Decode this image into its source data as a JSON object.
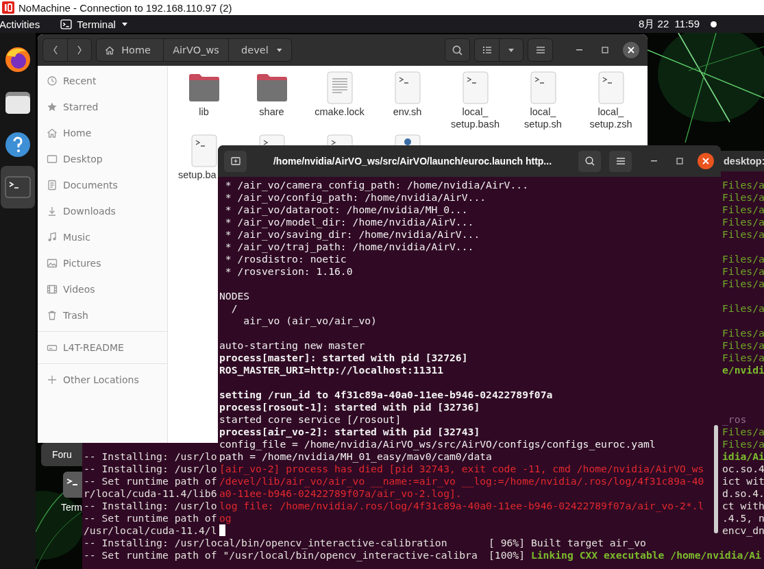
{
  "remote_window": {
    "title": "NoMachine - Connection to 192.168.110.97 (2)"
  },
  "top_bar": {
    "activities": "Activities",
    "app_menu": "Terminal",
    "clock": "8月 22  11:59"
  },
  "dock": {
    "items": [
      {
        "kind": "browser",
        "selected": false
      },
      {
        "kind": "files",
        "selected": false
      },
      {
        "kind": "help",
        "selected": false
      },
      {
        "kind": "terminal",
        "selected": true
      }
    ]
  },
  "desktop_items": [
    {
      "label": "Foru",
      "selected": true
    },
    {
      "label": "Term",
      "kind": "terminal",
      "selected": false
    }
  ],
  "terminal_behind_left": {
    "lines": [
      {
        "text": "-- Installing: /usr/lo"
      },
      {
        "text": "-- Installing: /usr/lo"
      },
      {
        "text": "-- Set runtime path of"
      },
      {
        "text": "r/local/cuda-11.4/lib6"
      },
      {
        "text": "-- Installing: /usr/lo"
      },
      {
        "text": "-- Set runtime path of"
      },
      {
        "text": "/usr/local/cuda-11.4/l"
      },
      {
        "text": "-- Installing: /usr/local/bin/opencv_interactive-calibration"
      },
      {
        "text": "-- Set runtime path of \"/usr/local/bin/opencv_interactive-calibra"
      }
    ]
  },
  "terminal_behind_right": {
    "title": "desktop:",
    "lines_right_edge": [
      {
        "text": "Files/a",
        "kind": "match"
      },
      {
        "text": "Files/a",
        "kind": "match"
      },
      {
        "text": "Files/a",
        "kind": "match"
      },
      {
        "text": "Files/a",
        "kind": "match"
      },
      {
        "text": "Files/a",
        "kind": "match"
      },
      {
        "kind": "blank"
      },
      {
        "text": "Files/a",
        "kind": "match"
      },
      {
        "text": "Files/a",
        "kind": "match"
      },
      {
        "text": "Files/a",
        "kind": "match"
      },
      {
        "kind": "blank"
      },
      {
        "text": "Files/a",
        "kind": "match"
      },
      {
        "kind": "blank"
      },
      {
        "text": "Files/a",
        "kind": "match"
      },
      {
        "text": "Files/a",
        "kind": "match"
      },
      {
        "text": "Files/a",
        "kind": "match"
      },
      {
        "text": "e/nvidi",
        "kind": "target"
      },
      {
        "kind": "blank"
      },
      {
        "kind": "blank"
      },
      {
        "kind": "blank"
      },
      {
        "text": "_ros",
        "kind": "muted"
      },
      {
        "text": "Files/a",
        "kind": "match"
      },
      {
        "text": "Files/a",
        "kind": "match"
      },
      {
        "text": "idia/Ai",
        "kind": "target"
      },
      {
        "text": "oc.so.4"
      },
      {
        "text": "ict wit"
      },
      {
        "text": "d.so.4."
      },
      {
        "text": "ct with"
      },
      {
        "text": ".4.5, n"
      },
      {
        "text": "encv_dn"
      }
    ],
    "lines": [
      {
        "text": "[ 96%] Built target air_vo"
      },
      {
        "spans": [
          {
            "text": "[100%] "
          },
          {
            "text": "Linking CXX executable /home/nvidia/Ai",
            "kind": "target"
          }
        ]
      }
    ]
  },
  "file_manager": {
    "path": [
      {
        "label": "Home",
        "kind": "home"
      },
      {
        "label": "AirVO_ws",
        "kind": "folder"
      },
      {
        "label": "devel",
        "kind": "current"
      }
    ],
    "sidebar": {
      "places": [
        {
          "label": "Recent",
          "kind": "recent"
        },
        {
          "label": "Starred",
          "kind": "starred"
        },
        {
          "label": "Home",
          "kind": "home"
        },
        {
          "label": "Desktop",
          "kind": "desktop"
        },
        {
          "label": "Documents",
          "kind": "documents"
        },
        {
          "label": "Downloads",
          "kind": "downloads"
        },
        {
          "label": "Music",
          "kind": "music"
        },
        {
          "label": "Pictures",
          "kind": "pictures"
        },
        {
          "label": "Videos",
          "kind": "videos"
        },
        {
          "label": "Trash",
          "kind": "trash"
        }
      ],
      "devices": [
        {
          "label": "L4T-README",
          "kind": "drive"
        }
      ],
      "other": [
        {
          "label": "Other Locations",
          "kind": "other"
        }
      ]
    },
    "files": [
      {
        "label": "lib",
        "kind": "folder",
        "partly_hidden": false
      },
      {
        "label": "share",
        "kind": "folder",
        "partly_hidden": false
      },
      {
        "label": "cmake.lock",
        "kind": "text",
        "partly_hidden": false
      },
      {
        "label": "env.sh",
        "kind": "script",
        "partly_hidden": false
      },
      {
        "label": "local_\nsetup.bash",
        "kind": "script",
        "partly_hidden": false
      },
      {
        "label": "local_\nsetup.sh",
        "kind": "script",
        "partly_hidden": false
      },
      {
        "label": "local_\nsetup.zsh",
        "kind": "script",
        "partly_hidden": false
      },
      {
        "label": "setup.ba",
        "kind": "script",
        "partly_hidden": true
      },
      {
        "kind": "script",
        "partly_hidden": true
      },
      {
        "kind": "script",
        "partly_hidden": true
      },
      {
        "kind": "python",
        "partly_hidden": true
      }
    ]
  },
  "terminal": {
    "title": "/home/nvidia/AirVO_ws/src/AirVO/launch/euroc.launch http...",
    "lines": [
      {
        "text": " * /air_vo/camera_config_path: /home/nvidia/AirV..."
      },
      {
        "text": " * /air_vo/config_path: /home/nvidia/AirV..."
      },
      {
        "text": " * /air_vo/dataroot: /home/nvidia/MH_0..."
      },
      {
        "text": " * /air_vo/model_dir: /home/nvidia/AirV..."
      },
      {
        "text": " * /air_vo/saving_dir: /home/nvidia/AirV..."
      },
      {
        "text": " * /air_vo/traj_path: /home/nvidia/AirV..."
      },
      {
        "text": " * /rosdistro: noetic"
      },
      {
        "text": " * /rosversion: 1.16.0"
      },
      {
        "kind": "blank"
      },
      {
        "text": "NODES"
      },
      {
        "text": "  /"
      },
      {
        "text": "    air_vo (air_vo/air_vo)"
      },
      {
        "kind": "blank"
      },
      {
        "text": "auto-starting new master"
      },
      {
        "text": "process[master]: started with pid [32726]",
        "kind": "bold"
      },
      {
        "text": "ROS_MASTER_URI=http://localhost:11311",
        "kind": "bold"
      },
      {
        "kind": "blank"
      },
      {
        "text": "setting /run_id to 4f31c89a-40a0-11ee-b946-02422789f07a",
        "kind": "bold"
      },
      {
        "text": "process[rosout-1]: started with pid [32736]",
        "kind": "bold"
      },
      {
        "text": "started core service [/rosout]"
      },
      {
        "text": "process[air_vo-2]: started with pid [32743]",
        "kind": "bold"
      },
      {
        "text": "config_file = /home/nvidia/AirVO_ws/src/AirVO/configs/configs_euroc.yaml"
      },
      {
        "text": "path = /home/nvidia/MH_01_easy/mav0/cam0/data"
      },
      {
        "text": "[air_vo-2] process has died [pid 32743, exit code -11, cmd /home/nvidia/AirVO_ws",
        "kind": "error"
      },
      {
        "text": "/devel/lib/air_vo/air_vo __name:=air_vo __log:=/home/nvidia/.ros/log/4f31c89a-40",
        "kind": "error"
      },
      {
        "text": "a0-11ee-b946-02422789f07a/air_vo-2.log].",
        "kind": "error"
      },
      {
        "text": "log file: /home/nvidia/.ros/log/4f31c89a-40a0-11ee-b946-02422789f07a/air_vo-2*.l",
        "kind": "error"
      },
      {
        "text": "og",
        "kind": "error"
      },
      {
        "kind": "cursor"
      }
    ]
  }
}
